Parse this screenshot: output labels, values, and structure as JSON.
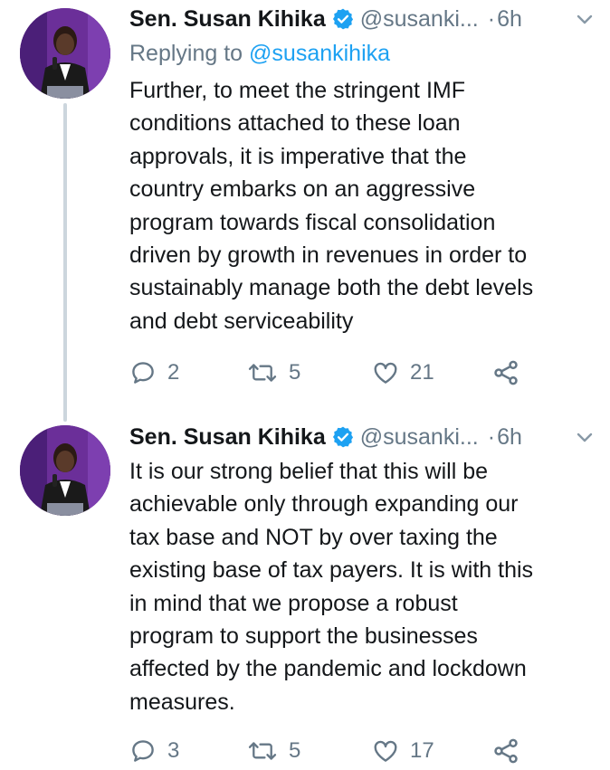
{
  "tweets": [
    {
      "author_name": "Sen. Susan Kihika",
      "handle": "@susanki...",
      "dot": "·",
      "time": "6h",
      "replying_label": "Replying to",
      "replying_handle": "@susankihika",
      "text_lines": [
        "Further, to meet the stringent IMF",
        "conditions attached to these loan",
        "approvals, it is imperative that the",
        "country embarks on an aggressive",
        "program towards fiscal consolidation",
        "driven by growth in revenues in order to",
        "sustainably manage both the debt levels",
        "and debt serviceability"
      ],
      "replies": "2",
      "retweets": "5",
      "likes": "21"
    },
    {
      "author_name": "Sen. Susan Kihika",
      "handle": "@susanki...",
      "dot": "·",
      "time": "6h",
      "text_lines": [
        "It is our strong belief that this will be",
        "achievable only through expanding our",
        "tax base and NOT by over taxing the",
        "existing base of tax payers. It is with this",
        "in mind that we propose a robust",
        "program to support the businesses",
        "affected by the pandemic and lockdown",
        "measures."
      ],
      "replies": "3",
      "retweets": "5",
      "likes": "17"
    }
  ],
  "colors": {
    "accent": "#1da1f2",
    "secondary_text": "#657786",
    "thread_line": "#ccd6dd",
    "avatar_bg": "#5a2a86"
  },
  "icons": [
    "verified-badge-icon",
    "chevron-down-icon",
    "reply-icon",
    "retweet-icon",
    "like-icon",
    "share-icon"
  ]
}
